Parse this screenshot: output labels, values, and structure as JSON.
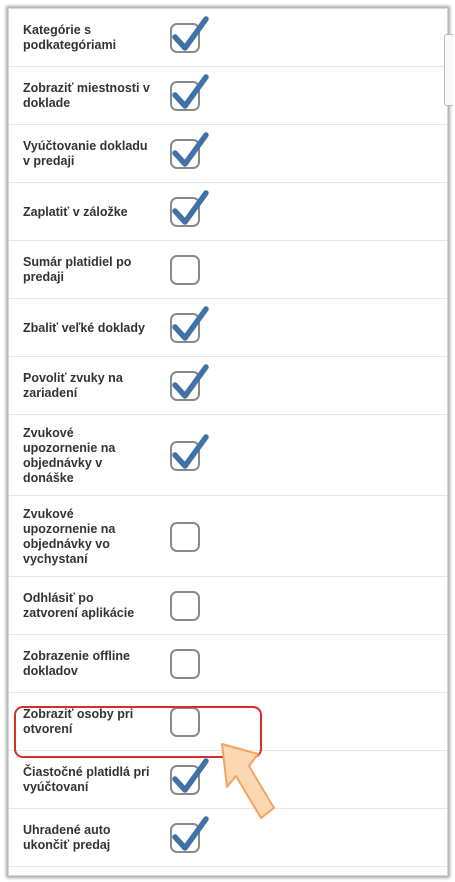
{
  "settings": {
    "items": [
      {
        "label": "Kategórie s podkategóriami",
        "checked": true
      },
      {
        "label": "Zobraziť miestnosti v doklade",
        "checked": true
      },
      {
        "label": "Vyúčtovanie dokladu v predaji",
        "checked": true
      },
      {
        "label": "Zaplatiť v záložke",
        "checked": true
      },
      {
        "label": "Sumár platidiel po predaji",
        "checked": false
      },
      {
        "label": "Zbaliť veľké doklady",
        "checked": true
      },
      {
        "label": "Povoliť zvuky na zariadení",
        "checked": true
      },
      {
        "label": "Zvukové upozornenie na objednávky v donáške",
        "checked": true
      },
      {
        "label": "Zvukové upozornenie na objednávky vo vychystaní",
        "checked": false
      },
      {
        "label": "Odhlásiť po zatvorení aplikácie",
        "checked": false
      },
      {
        "label": "Zobrazenie offline dokladov",
        "checked": false
      },
      {
        "label": "Zobraziť osoby pri otvorení",
        "checked": false
      },
      {
        "label": "Čiastočné platidlá pri vyúčtovaní",
        "checked": true
      },
      {
        "label": "Uhradené auto ukončiť predaj",
        "checked": true
      }
    ]
  },
  "colors": {
    "checkmark": "#3f73a8",
    "checkbox_border": "#8a8a8a",
    "highlight": "#d32f2f",
    "arrow_fill": "#fbd7b2",
    "arrow_stroke": "#f0a560"
  },
  "icons": {
    "checked": "check-icon",
    "pointer": "arrow-pointer-icon"
  }
}
